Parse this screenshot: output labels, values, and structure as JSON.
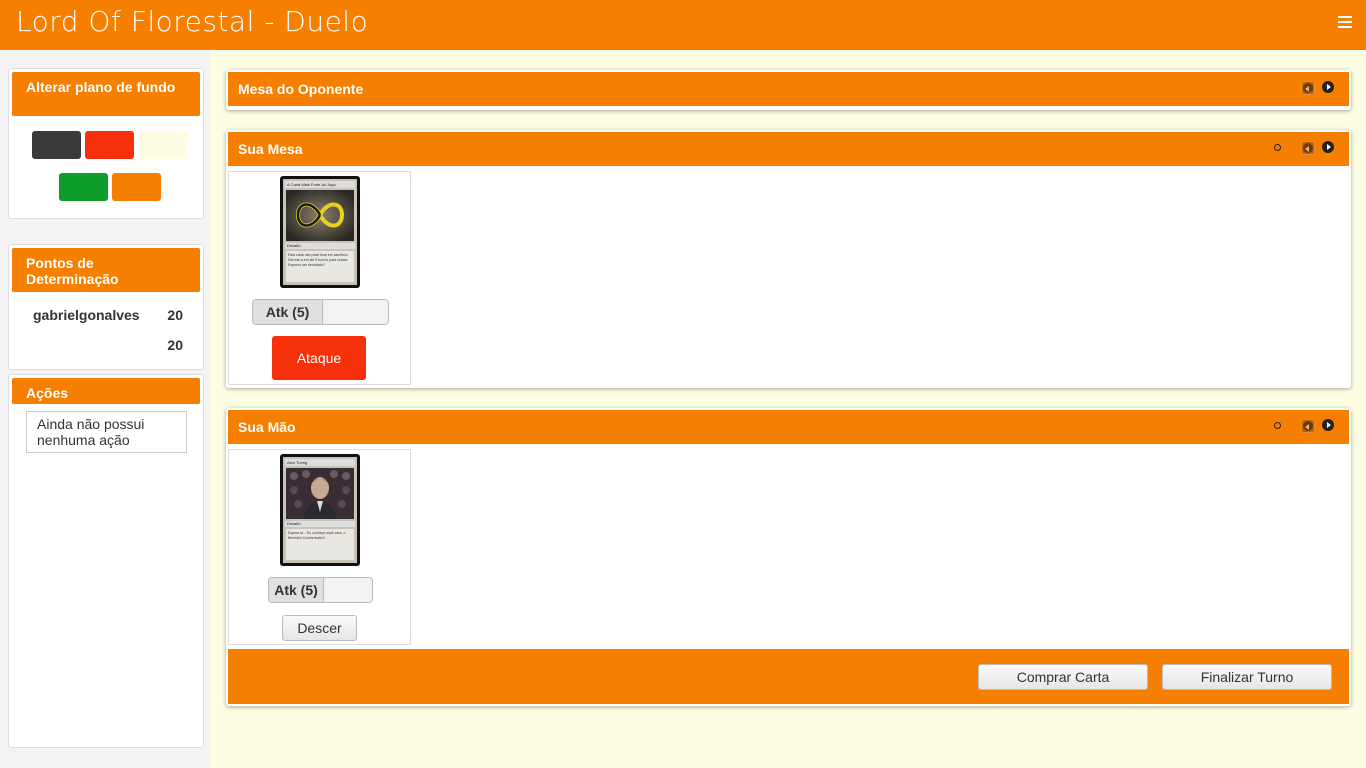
{
  "header": {
    "title": "Lord Of Florestal - Duelo",
    "menu_icon": "hamburger-icon"
  },
  "sidebar": {
    "background_panel": {
      "title": "Alterar plano de fundo",
      "swatches": [
        "#3a3a3a",
        "#f5300a",
        "#fdfde4",
        "#0e9c2a",
        "#f77f00"
      ]
    },
    "points_panel": {
      "title": "Pontos de Determinação",
      "rows": [
        {
          "name": "gabrielgonalves",
          "points": "20"
        },
        {
          "name": "",
          "points": "20"
        }
      ]
    },
    "actions_panel": {
      "title": "Ações",
      "empty_text": "Ainda não possui nenhuma ação"
    }
  },
  "opponent_table": {
    "title": "Mesa do Oponente"
  },
  "your_table": {
    "title": "Sua Mesa",
    "cards": [
      {
        "name": "A Carta Mais Forte do Jogo",
        "type": "Desafio",
        "text": "Esta carta não pode ficar em sacrifício. Derrote-a em até 5 turnos para vencer. Esperou ser derrotado?",
        "art": "infinity-art",
        "attack_label": "Atk (5)",
        "action_label": "Ataque"
      }
    ]
  },
  "your_hand": {
    "title": "Sua Mão",
    "cards": [
      {
        "name": "Alan Turing",
        "type": "Desafio",
        "text": "Espera aí... Eu conheço esse cara, o Benedict Cumberbatch!",
        "art": "portrait-art",
        "attack_label": "Atk (5)",
        "action_label": "Descer"
      }
    ],
    "buttons": {
      "draw": "Comprar Carta",
      "end_turn": "Finalizar Turno"
    }
  },
  "colors": {
    "accent": "#f77f00",
    "attack": "#f5300a",
    "page_bg": "#fdfde4"
  }
}
